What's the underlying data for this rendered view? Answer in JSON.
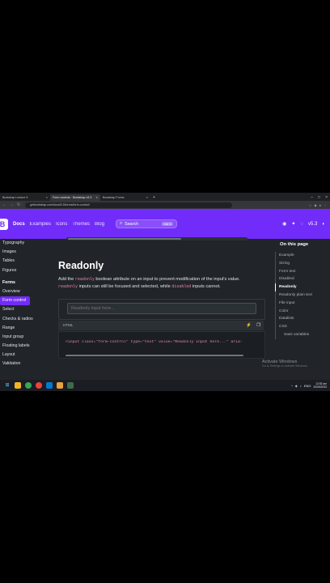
{
  "browser": {
    "tabs": [
      {
        "label": "Bootstrap Lecture 9"
      },
      {
        "label": "Form controls · Bootstrap v5.3"
      },
      {
        "label": "Bootstrap Forms"
      }
    ],
    "url": "getbootstrap.com/docs/5.3/forms/form-control/"
  },
  "navbar": {
    "brand": "B",
    "links": [
      "Docs",
      "Examples",
      "Icons",
      "Themes",
      "Blog"
    ],
    "search_label": "Search",
    "search_kbd": "Ctrl K",
    "version": "v5.3"
  },
  "sidebar": {
    "items_top": [
      "Typography",
      "Images",
      "Tables",
      "Figures"
    ],
    "section": "Forms",
    "items": [
      "Overview",
      "Form control",
      "Select",
      "Checks & radios",
      "Range",
      "Input group",
      "Floating labels",
      "Layout",
      "Validation"
    ]
  },
  "main": {
    "heading": "Readonly",
    "lead_1": "Add the ",
    "lead_code_1": "readonly",
    "lead_2": " boolean attribute on an input to prevent modification of the input's value. ",
    "lead_code_2": "readonly",
    "lead_3": " inputs can still be focused and selected, while ",
    "lead_code_3": "disabled",
    "lead_4": " inputs cannot.",
    "example_placeholder": "Readonly input here...",
    "code_lang": "HTML",
    "code_line": "<input class=\"form-control\" type=\"text\" value=\"Readonly input here...\" aria-"
  },
  "toc": {
    "title": "On this page",
    "entries": [
      "Example",
      "Sizing",
      "Form text",
      "Disabled",
      "Readonly",
      "Readonly plain text",
      "File input",
      "Color",
      "Datalists",
      "CSS"
    ],
    "sub_entry": "Sass variables"
  },
  "watermark": {
    "title": "Activate Windows",
    "subtitle": "Go to Settings to activate Windows."
  },
  "taskbar": {
    "time": "12:52 am",
    "date": "20/09/2023",
    "lang": "ENG"
  }
}
